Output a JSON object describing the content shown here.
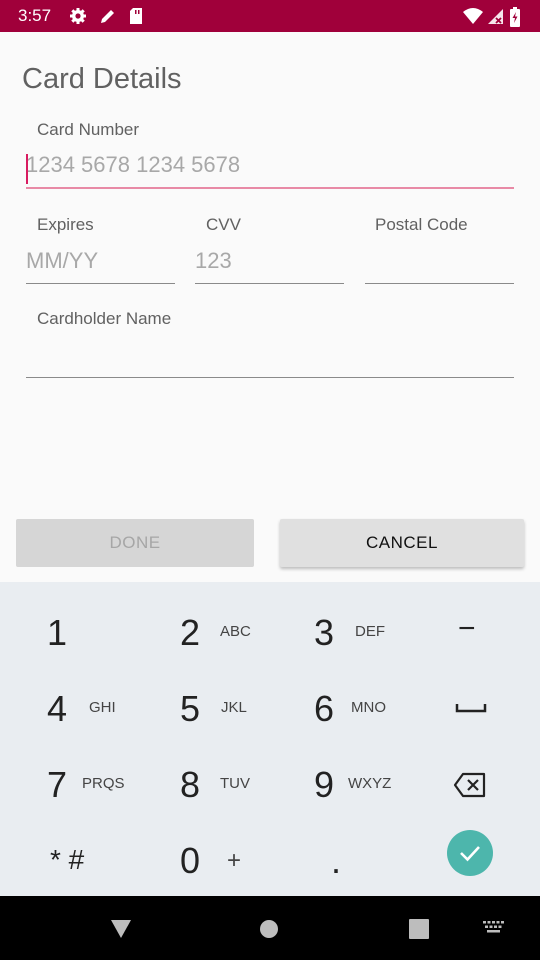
{
  "status_bar": {
    "time": "3:57",
    "icons": [
      "gear-icon",
      "pencil-icon",
      "sd-card-icon",
      "wifi-icon",
      "no-signal-icon",
      "battery-icon"
    ]
  },
  "form": {
    "title": "Card Details",
    "card_number": {
      "label": "Card Number",
      "placeholder": "1234 5678 1234 5678",
      "value": ""
    },
    "expires": {
      "label": "Expires",
      "placeholder": "MM/YY",
      "value": ""
    },
    "cvv": {
      "label": "CVV",
      "placeholder": "123",
      "value": ""
    },
    "postal_code": {
      "label": "Postal Code",
      "placeholder": "",
      "value": ""
    },
    "cardholder_name": {
      "label": "Cardholder Name",
      "placeholder": "",
      "value": ""
    }
  },
  "buttons": {
    "done": "DONE",
    "cancel": "CANCEL"
  },
  "keyboard": {
    "rows": [
      [
        {
          "num": "1",
          "sub": ""
        },
        {
          "num": "2",
          "sub": "ABC"
        },
        {
          "num": "3",
          "sub": "DEF"
        },
        {
          "num": "−",
          "sub": ""
        }
      ],
      [
        {
          "num": "4",
          "sub": "GHI"
        },
        {
          "num": "5",
          "sub": "JKL"
        },
        {
          "num": "6",
          "sub": "MNO"
        },
        {
          "num": "",
          "sub": "",
          "icon": "space-icon"
        }
      ],
      [
        {
          "num": "7",
          "sub": "PRQS"
        },
        {
          "num": "8",
          "sub": "TUV"
        },
        {
          "num": "9",
          "sub": "WXYZ"
        },
        {
          "num": "",
          "sub": "",
          "icon": "backspace-icon"
        }
      ],
      [
        {
          "num": "* #",
          "sub": ""
        },
        {
          "num": "0",
          "sub": "+"
        },
        {
          "num": ".",
          "sub": ""
        },
        {
          "num": "",
          "sub": "",
          "icon": "check-icon"
        }
      ]
    ]
  },
  "nav_bar": {
    "icons": [
      "back-icon",
      "home-icon",
      "recents-icon",
      "keyboard-icon"
    ]
  },
  "colors": {
    "status_bar": "#a0003a",
    "accent": "#e88aa6",
    "go_key": "#4db6ac",
    "keyboard_bg": "#e9edf1"
  }
}
